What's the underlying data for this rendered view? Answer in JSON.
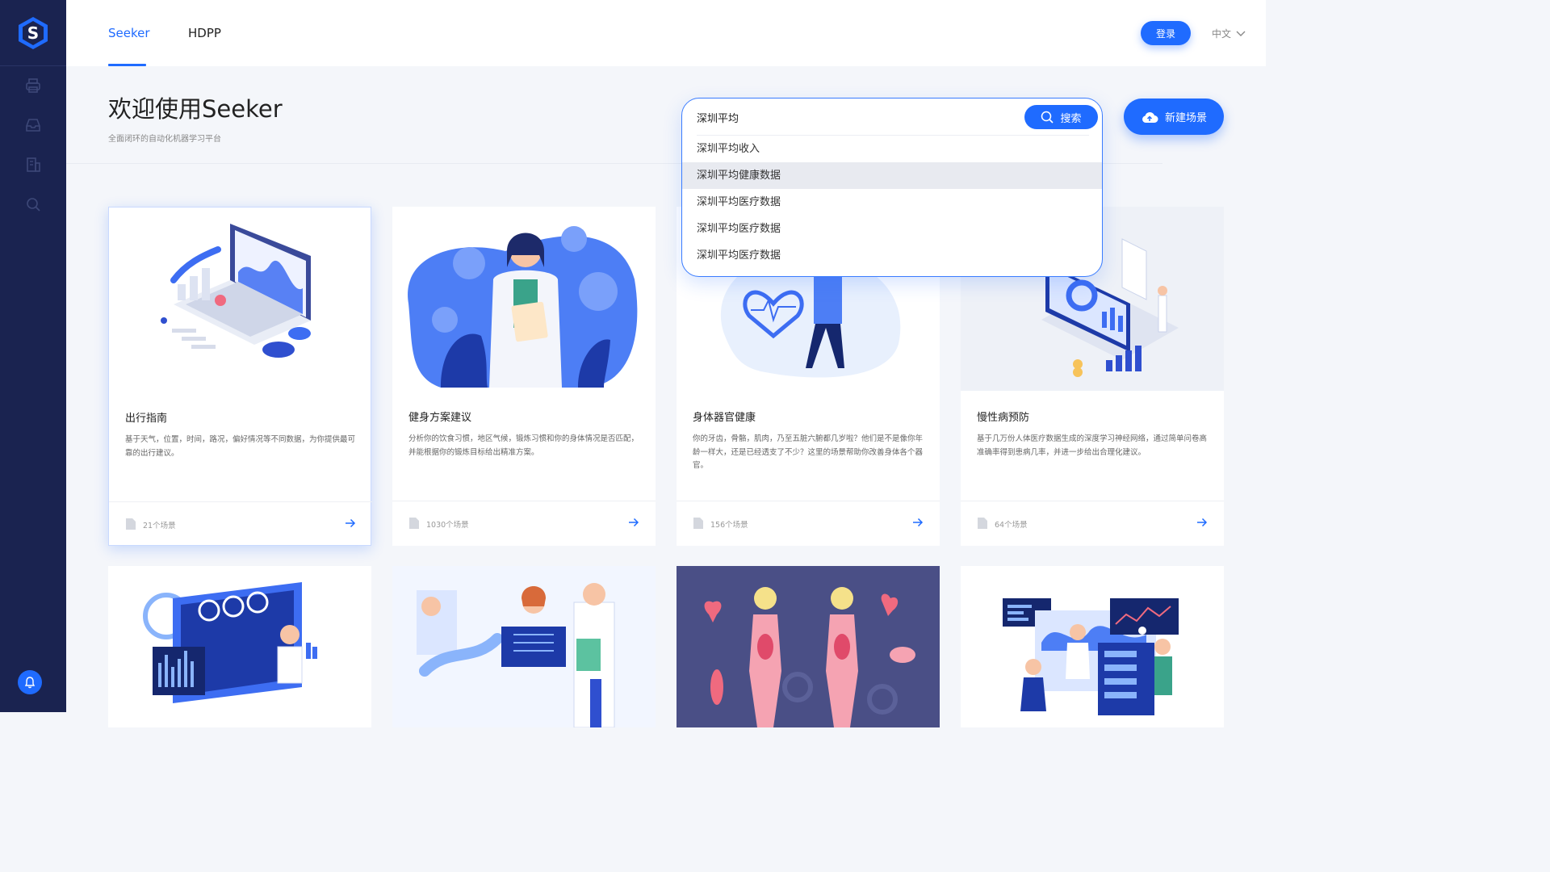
{
  "sidebar": {
    "logo_letter": "S",
    "icons": [
      "printer-icon",
      "inbox-icon",
      "building-icon",
      "search-user-icon"
    ],
    "bell_icon": "bell-icon"
  },
  "header": {
    "tabs": [
      {
        "label": "Seeker",
        "active": true
      },
      {
        "label": "HDPP",
        "active": false
      }
    ],
    "login_label": "登录",
    "language": "中文"
  },
  "page": {
    "title": "欢迎使用Seeker",
    "subtitle": "全面闭环的自动化机器学习平台"
  },
  "search": {
    "value": "深圳平均",
    "button_label": "搜索",
    "suggestions": [
      "深圳平均收入",
      "深圳平均健康数据",
      "深圳平均医疗数据",
      "深圳平均医疗数据",
      "深圳平均医疗数据"
    ],
    "highlighted_index": 1
  },
  "new_scene_label": "新建场景",
  "cards": [
    {
      "title": "出行指南",
      "desc": "基于天气，位置，时间，路况，偏好情况等不同数据，为你提供最可靠的出行建议。",
      "count": "21个场景"
    },
    {
      "title": "健身方案建议",
      "desc": "分析你的饮食习惯，地区气候，锻炼习惯和你的身体情况是否匹配，并能根据你的锻炼目标给出精准方案。",
      "count": "1030个场景"
    },
    {
      "title": "身体器官健康",
      "desc": "你的牙齿，骨骼，肌肉，乃至五脏六腑都几岁啦？他们是不是像你年龄一样大，还是已经透支了不少？这里的场景帮助你改善身体各个器官。",
      "count": "156个场景"
    },
    {
      "title": "慢性病预防",
      "desc": "基于几万份人体医疗数据生成的深度学习神经网络，通过简单问卷高准确率得到患病几率，并进一步给出合理化建议。",
      "count": "64个场景"
    }
  ],
  "colors": {
    "accent": "#1f6bff",
    "sidebar": "#1a2350",
    "page_bg": "#f4f6fa"
  }
}
